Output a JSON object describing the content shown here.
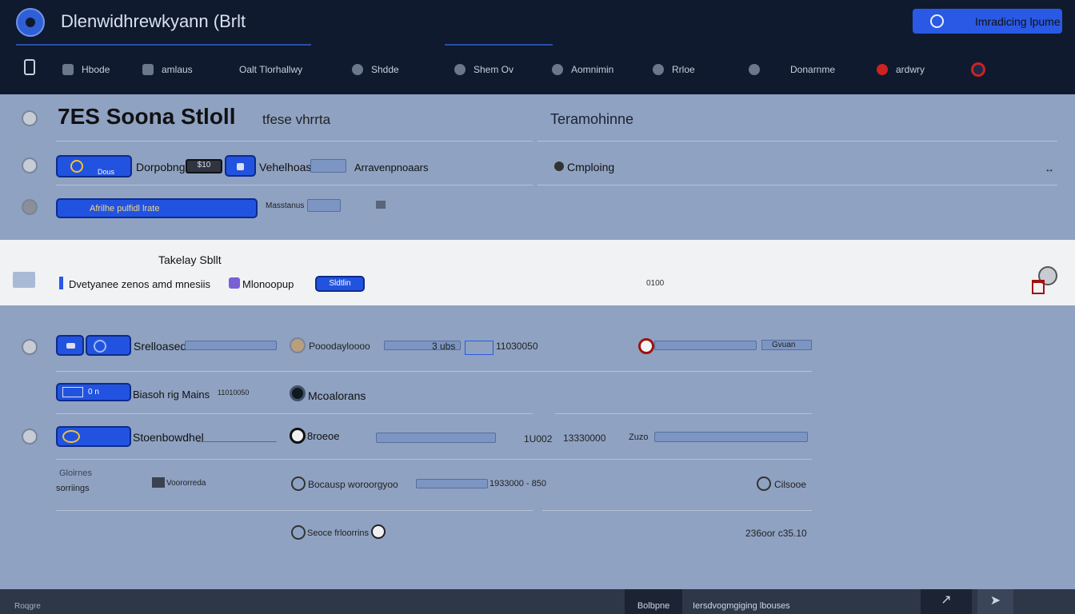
{
  "app": {
    "title": "Dlenwidhrewkyann (Brlt",
    "top_action": "Imradicing lpume"
  },
  "nav": [
    {
      "label": "Hbode"
    },
    {
      "label": "amlaus"
    },
    {
      "label": "Oalt Tlorhallwy"
    },
    {
      "label": "Shdde"
    },
    {
      "label": "Shem Ov"
    },
    {
      "label": "Aomnimin"
    },
    {
      "label": "Rrloe"
    },
    {
      "label": "Donarnme"
    },
    {
      "label": "ardwry"
    }
  ],
  "panel": {
    "headline": "7ES Soona Stloll",
    "headline_sub": "tfese vhrrta",
    "right_title": "Teramohinne",
    "row1": {
      "button": "Dous",
      "label": "Dorpobng",
      "chip_value": "$10",
      "field_label": "Vehelhoasb",
      "right_label": "Arravenpnoaars",
      "status_label": "Cmploing"
    },
    "row2": {
      "input_text": "Afrilhe pulfidl lrate",
      "label": "Masstanus"
    }
  },
  "strip": {
    "title": "Takelay Sbllt",
    "text": "Dvetyanee zenos amd mnesiis",
    "tag": "Mlonoopup",
    "button": "Sldtlin",
    "value": "0100"
  },
  "list": {
    "r1": {
      "label": "Srelloased",
      "mid": "Pooodayloooo",
      "mid_val": "3 ubs",
      "num": "11030050",
      "right_label": "Gvuan"
    },
    "r2": {
      "button_text": "0 n",
      "label": "Biasoh rig Mains",
      "small": "11010050",
      "mid": "Mcoalorans"
    },
    "r3": {
      "label": "Stoenbowdhel",
      "mid": "8roeoe",
      "num1": "1U002",
      "num2": "13330000",
      "tag": "Zuzo"
    },
    "r4": {
      "top": "Gloirnes",
      "sub": "sorriings",
      "mid_small": "Voororreda",
      "mid": "Bocausp woroorgyoo",
      "mid_num": "1933000 - 850",
      "right": "Cilsooe"
    },
    "r5": {
      "mid": "Seoce frloorrins",
      "right": "236oor c35.10"
    }
  },
  "footer": {
    "left": "Roqgre",
    "tab": "Bolbpne",
    "text": "Iersdvogmgiging lbouses"
  },
  "colors": {
    "accent": "#2a59e6",
    "topbar": "#0f1a2e",
    "panel": "#8fa2c2",
    "danger": "#c22222"
  }
}
